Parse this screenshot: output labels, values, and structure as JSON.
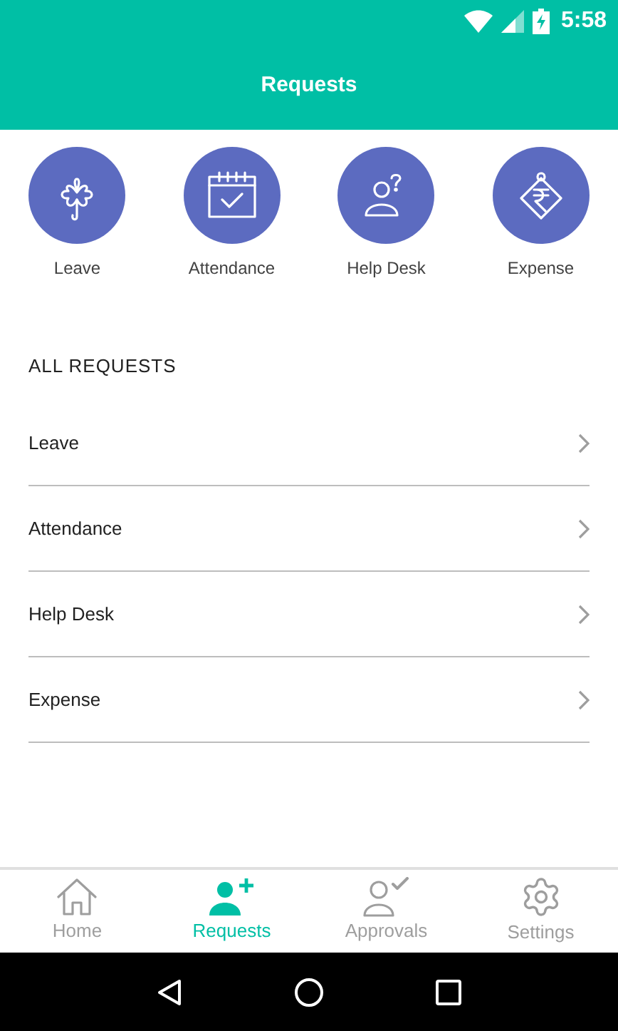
{
  "status_bar": {
    "time": "5:58"
  },
  "header": {
    "title": "Requests"
  },
  "quick_actions": [
    {
      "label": "Leave",
      "kind": "clover"
    },
    {
      "label": "Attendance",
      "kind": "calendar"
    },
    {
      "label": "Help Desk",
      "kind": "helpdesk"
    },
    {
      "label": "Expense",
      "kind": "rupee"
    }
  ],
  "section_title": "ALL REQUESTS",
  "requests": [
    {
      "label": "Leave"
    },
    {
      "label": "Attendance"
    },
    {
      "label": "Help Desk"
    },
    {
      "label": "Expense"
    }
  ],
  "bottom_nav": [
    {
      "label": "Home",
      "kind": "home",
      "selected": false
    },
    {
      "label": "Requests",
      "kind": "requests",
      "selected": true
    },
    {
      "label": "Approvals",
      "kind": "approvals",
      "selected": false
    },
    {
      "label": "Settings",
      "kind": "settings",
      "selected": false
    }
  ]
}
